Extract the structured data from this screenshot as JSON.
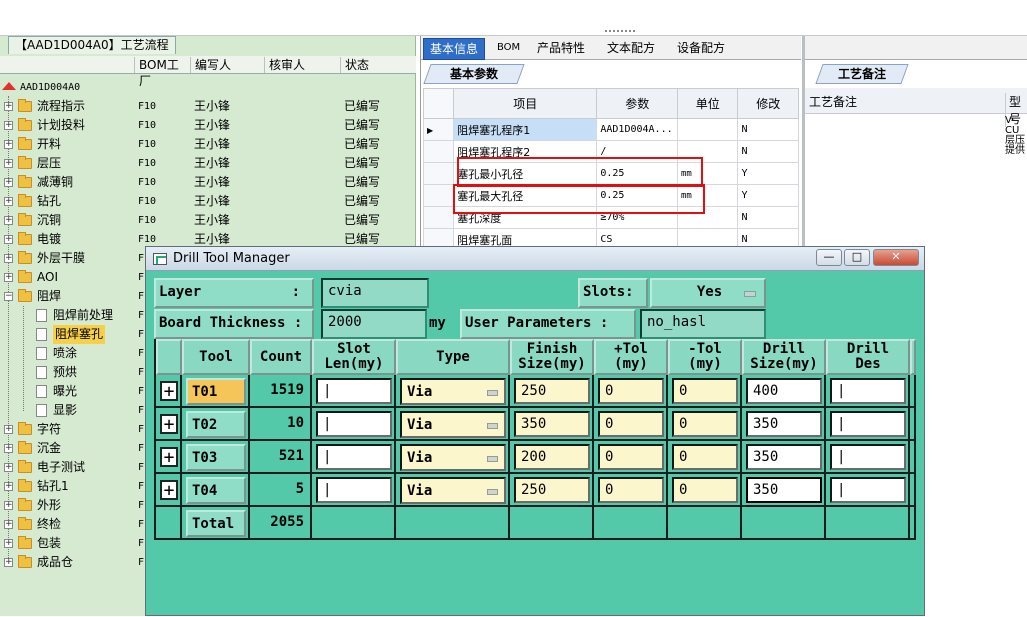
{
  "left_panel": {
    "title": "【AAD1D004A0】工艺流程",
    "columns": [
      "BOM工厂",
      "编写人",
      "核审人",
      "状态"
    ],
    "root": "AAD1D004A0",
    "items": [
      {
        "name": "流程指示",
        "bom": "F10",
        "author": "王小锋",
        "status": "已编写",
        "level": 1,
        "type": "folder"
      },
      {
        "name": "计划投料",
        "bom": "F10",
        "author": "王小锋",
        "status": "已编写",
        "level": 1,
        "type": "folder"
      },
      {
        "name": "开料",
        "bom": "F10",
        "author": "王小锋",
        "status": "已编写",
        "level": 1,
        "type": "folder"
      },
      {
        "name": "层压",
        "bom": "F10",
        "author": "王小锋",
        "status": "已编写",
        "level": 1,
        "type": "folder"
      },
      {
        "name": "减薄铜",
        "bom": "F10",
        "author": "王小锋",
        "status": "已编写",
        "level": 1,
        "type": "folder"
      },
      {
        "name": "钻孔",
        "bom": "F10",
        "author": "王小锋",
        "status": "已编写",
        "level": 1,
        "type": "folder"
      },
      {
        "name": "沉铜",
        "bom": "F10",
        "author": "王小锋",
        "status": "已编写",
        "level": 1,
        "type": "folder"
      },
      {
        "name": "电镀",
        "bom": "F10",
        "author": "王小锋",
        "status": "已编写",
        "level": 1,
        "type": "folder"
      },
      {
        "name": "外层干膜",
        "bom": "F",
        "author": "",
        "status": "",
        "level": 1,
        "type": "folder"
      },
      {
        "name": "AOI",
        "bom": "F",
        "author": "",
        "status": "",
        "level": 1,
        "type": "folder"
      },
      {
        "name": "阻焊",
        "bom": "F",
        "author": "",
        "status": "",
        "level": 1,
        "type": "folder-open"
      },
      {
        "name": "阻焊前处理",
        "bom": "F",
        "author": "",
        "status": "",
        "level": 2,
        "type": "doc"
      },
      {
        "name": "阻焊塞孔",
        "bom": "F",
        "author": "",
        "status": "",
        "level": 2,
        "type": "doc",
        "selected": true
      },
      {
        "name": "喷涂",
        "bom": "F",
        "author": "",
        "status": "",
        "level": 2,
        "type": "doc"
      },
      {
        "name": "预烘",
        "bom": "F",
        "author": "",
        "status": "",
        "level": 2,
        "type": "doc"
      },
      {
        "name": "曝光",
        "bom": "F",
        "author": "",
        "status": "",
        "level": 2,
        "type": "doc"
      },
      {
        "name": "显影",
        "bom": "F",
        "author": "",
        "status": "",
        "level": 2,
        "type": "doc"
      },
      {
        "name": "字符",
        "bom": "F",
        "author": "",
        "status": "",
        "level": 1,
        "type": "folder"
      },
      {
        "name": "沉金",
        "bom": "F",
        "author": "",
        "status": "",
        "level": 1,
        "type": "folder"
      },
      {
        "name": "电子测试",
        "bom": "F",
        "author": "",
        "status": "",
        "level": 1,
        "type": "folder"
      },
      {
        "name": "钻孔1",
        "bom": "F",
        "author": "",
        "status": "",
        "level": 1,
        "type": "folder"
      },
      {
        "name": "外形",
        "bom": "F",
        "author": "",
        "status": "",
        "level": 1,
        "type": "folder"
      },
      {
        "name": "终检",
        "bom": "F",
        "author": "",
        "status": "",
        "level": 1,
        "type": "folder"
      },
      {
        "name": "包装",
        "bom": "F",
        "author": "",
        "status": "",
        "level": 1,
        "type": "folder"
      },
      {
        "name": "成品仓",
        "bom": "F",
        "author": "",
        "status": "",
        "level": 1,
        "type": "folder"
      }
    ]
  },
  "tabs": [
    "基本信息",
    "BOM",
    "产品特性",
    "文本配方",
    "设备配方"
  ],
  "basic_subtab": "基本参数",
  "param_table": {
    "headers": [
      "项目",
      "参数",
      "单位",
      "修改"
    ],
    "rows": [
      {
        "item": "阻焊塞孔程序1",
        "param": "AAD1D004A...",
        "unit": "",
        "mod": "N"
      },
      {
        "item": "阻焊塞孔程序2",
        "param": "/",
        "unit": "",
        "mod": "N"
      },
      {
        "item": "塞孔最小孔径",
        "param": "0.25",
        "unit": "mm",
        "mod": "Y"
      },
      {
        "item": "塞孔最大孔径",
        "param": "0.25",
        "unit": "mm",
        "mod": "Y"
      },
      {
        "item": "塞孔深度",
        "param": "≥70%",
        "unit": "",
        "mod": "N"
      },
      {
        "item": "阻焊塞孔面",
        "param": "CS",
        "unit": "",
        "mod": "N"
      }
    ]
  },
  "notes": {
    "tab": "工艺备注",
    "header": "工艺备注",
    "col2": "型号",
    "lines": [
      "V-CU",
      "层压",
      "提供"
    ]
  },
  "dialog": {
    "title": "Drill Tool Manager",
    "layer_label": "Layer",
    "layer_colon": ":",
    "layer_value": "cvia",
    "slots_label": "Slots:",
    "slots_value": "Yes",
    "thickness_label": "Board Thickness :",
    "thickness_value": "2000",
    "thickness_unit": "my",
    "user_params_label": "User Parameters :",
    "user_params_value": "no_hasl",
    "columns": {
      "tool": "Tool",
      "count": "Count",
      "slot1": "Slot",
      "slot2": "Len(my)",
      "type": "Type",
      "finish1": "Finish",
      "finish2": "Size(my)",
      "ptol1": "+Tol",
      "ptol2": "(my)",
      "ntol1": "-Tol",
      "ntol2": "(my)",
      "drill1": "Drill",
      "drill2": "Size(my)",
      "des1": "Drill",
      "des2": "Des"
    },
    "rows": [
      {
        "tool": "T01",
        "count": "1519",
        "type": "Via",
        "finish": "250",
        "ptol": "0",
        "ntol": "0",
        "drill": "400"
      },
      {
        "tool": "T02",
        "count": "10",
        "type": "Via",
        "finish": "350",
        "ptol": "0",
        "ntol": "0",
        "drill": "350"
      },
      {
        "tool": "T03",
        "count": "521",
        "type": "Via",
        "finish": "200",
        "ptol": "0",
        "ntol": "0",
        "drill": "350"
      },
      {
        "tool": "T04",
        "count": "5",
        "type": "Via",
        "finish": "250",
        "ptol": "0",
        "ntol": "0",
        "drill": "350"
      }
    ],
    "total_label": "Total",
    "total_value": "2055"
  }
}
